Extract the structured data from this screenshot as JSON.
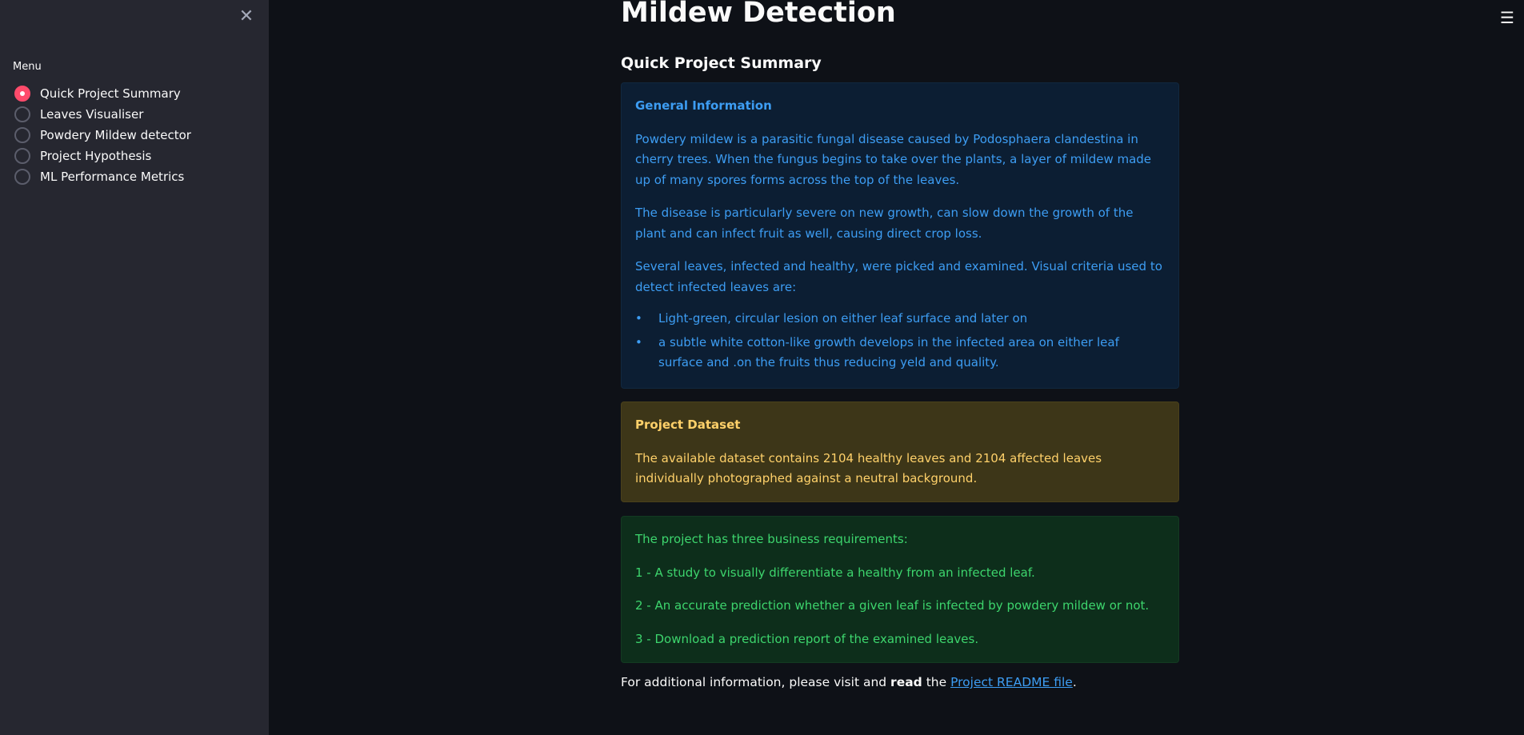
{
  "sidebar": {
    "close_glyph": "✕",
    "menu_label": "Menu",
    "items": [
      {
        "label": "Quick Project Summary",
        "selected": true
      },
      {
        "label": "Leaves Visualiser",
        "selected": false
      },
      {
        "label": "Powdery Mildew detector",
        "selected": false
      },
      {
        "label": "Project Hypothesis",
        "selected": false
      },
      {
        "label": "ML Performance Metrics",
        "selected": false
      }
    ]
  },
  "header": {
    "hamburger_glyph": "☰"
  },
  "main": {
    "title": "Mildew Detection",
    "subheader": "Quick Project Summary",
    "info": {
      "heading": "General Information",
      "p1": "Powdery mildew is a parasitic fungal disease caused by Podosphaera clandestina in cherry trees. When the fungus begins to take over the plants, a layer of mildew made up of many spores forms across the top of the leaves.",
      "p2": "The disease is particularly severe on new growth, can slow down the growth of the plant and can infect fruit as well, causing direct crop loss.",
      "p3": "Several leaves, infected and healthy, were picked and examined. Visual criteria used to detect infected leaves are:",
      "bullets": [
        "Light-green, circular lesion on either leaf surface and later on",
        "a subtle white cotton-like growth develops in the infected area on either leaf surface and .on the fruits thus reducing yeld and quality."
      ]
    },
    "dataset": {
      "heading": "Project Dataset",
      "text": "The available dataset contains 2104 healthy leaves and 2104 affected leaves individually photographed against a neutral background."
    },
    "requirements": {
      "intro": "The project has three business requirements:",
      "r1": "1 - A study to visually differentiate a healthy from an infected leaf.",
      "r2": "2 - An accurate prediction whether a given leaf is infected by powdery mildew or not.",
      "r3": "3 - Download a prediction report of the examined leaves."
    },
    "footer": {
      "prefix": "For additional information, please visit and ",
      "bold": "read",
      "middle": " the ",
      "link": "Project README file",
      "suffix": "."
    }
  },
  "colors": {
    "background": "#0e1117",
    "sidebar": "#262730",
    "accent": "#ff4b6b",
    "info_text": "#3d9df3",
    "warning_text": "#ffd16a",
    "success_text": "#3dd56d"
  }
}
